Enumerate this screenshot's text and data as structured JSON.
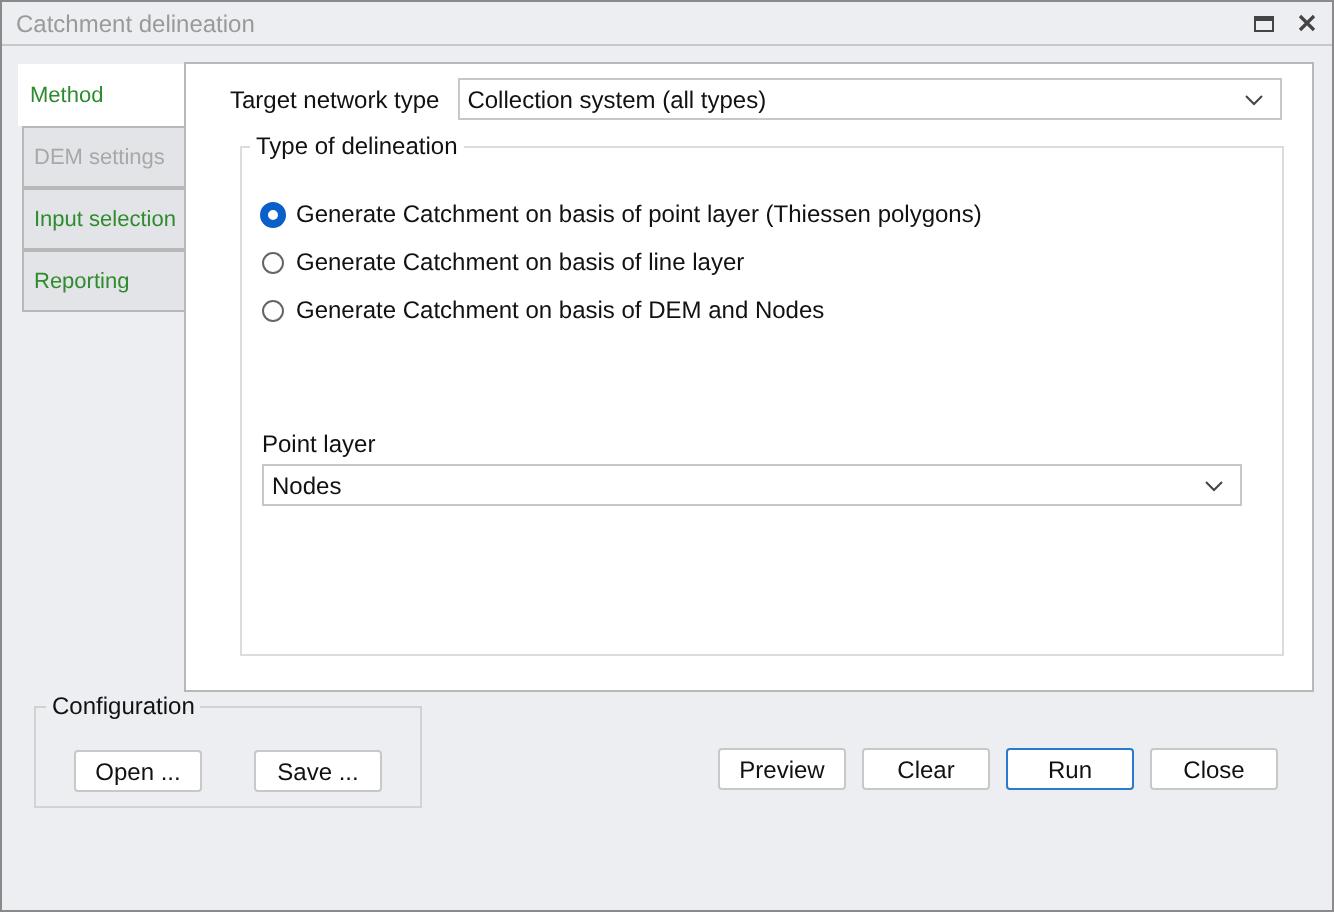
{
  "window": {
    "title": "Catchment delineation"
  },
  "tabs": [
    {
      "label": "Method",
      "selected": true,
      "disabled": false
    },
    {
      "label": "DEM settings",
      "selected": false,
      "disabled": true
    },
    {
      "label": "Input selection",
      "selected": false,
      "disabled": false
    },
    {
      "label": "Reporting",
      "selected": false,
      "disabled": false
    }
  ],
  "target_network_type": {
    "label": "Target network type",
    "value": "Collection system (all types)"
  },
  "type_of_delineation": {
    "title": "Type of delineation",
    "options": [
      {
        "label": "Generate Catchment on basis of point layer (Thiessen polygons)",
        "selected": true
      },
      {
        "label": "Generate Catchment on basis of line layer",
        "selected": false
      },
      {
        "label": "Generate Catchment on basis of DEM and Nodes",
        "selected": false
      }
    ],
    "point_layer": {
      "label": "Point layer",
      "value": "Nodes"
    }
  },
  "configuration": {
    "title": "Configuration",
    "buttons": [
      "Open ...",
      "Save ..."
    ]
  },
  "buttons": [
    {
      "label": "Preview",
      "default": false
    },
    {
      "label": "Clear",
      "default": false
    },
    {
      "label": "Run",
      "default": true
    },
    {
      "label": "Close",
      "default": false
    }
  ]
}
